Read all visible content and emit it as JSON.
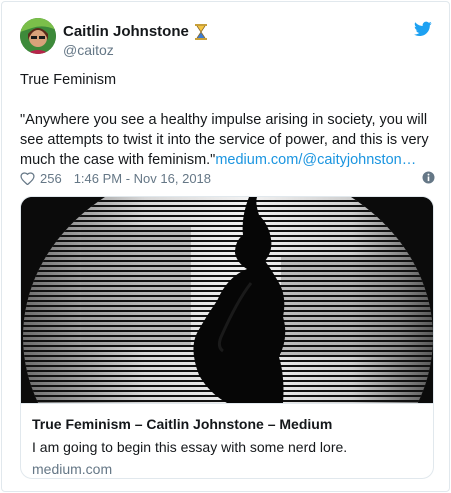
{
  "author": {
    "name": "Caitlin Johnstone",
    "handle": "@caitoz",
    "avatar_icon": "user-avatar",
    "badge_icon": "hourglass-icon"
  },
  "tweet": {
    "title": "True Feminism",
    "text": "\"Anywhere you see a healthy impulse arising in society, you will see attempts to twist it into the service of power, and this is very much the case with feminism.\"",
    "link": "medium.com/@caityjohnston…"
  },
  "meta": {
    "likes": "256",
    "timestamp": "1:46 PM - Nov 16, 2018"
  },
  "card": {
    "title": "True Feminism – Caitlin Johnstone – Medium",
    "description": "I am going to begin this essay with some nerd lore.",
    "domain": "medium.com"
  },
  "colors": {
    "link": "#1b95e0",
    "twitter_blue": "#1da1f2",
    "muted": "#657786",
    "border": "#e1e8ed"
  }
}
